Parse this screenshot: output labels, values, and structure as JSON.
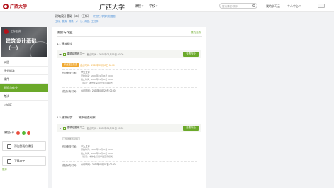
{
  "header": {
    "logo_text": "广西大学",
    "brand": "广西大学",
    "nav_course": "课程",
    "nav_school": "学校",
    "search_placeholder": "搜索课程/教师",
    "my_study": "我的学习云",
    "personal_center": "个人中心"
  },
  "course": {
    "title": "建筑设计基础（二）（王标）",
    "meta": "研究院 | 学校与校园圈",
    "teachers": "王标、樊鹏、曾锐、卢一沙、胡亚、王红孝"
  },
  "sidebar": {
    "cover_small": "王标主讲",
    "cover_title": "建筑设计基础（一）",
    "items": [
      {
        "label": "公告"
      },
      {
        "label": "评分标准"
      },
      {
        "label": "课件"
      },
      {
        "label": "测验与作业"
      },
      {
        "label": "考试"
      },
      {
        "label": "讨论区"
      }
    ],
    "share_label": "课程分享",
    "tool_1": "添加到我的课程",
    "tool_2": "下载APP",
    "collapse": "展开"
  },
  "main": {
    "heading": "测验与作业",
    "link": "提交记录",
    "sections": [
      {
        "title": "1.1 建筑初步",
        "task_name": "建筑绘图练习一",
        "task_date": "截止时间：2020年03月15日 00:00",
        "button": "查看作业",
        "tag": "作业提交状态",
        "tag_date": "截止时间：2020年03月15日 00:00",
        "rows": [
          {
            "label": "作业批改时间：",
            "lines": [
              "学生互评",
              "开始时间：2020年03月16日 00:00",
              "截止时间：2020年03月18日 00:00",
              "（提示：本作业采用学生互评模式）"
            ]
          },
          {
            "label": "成绩公布时间：",
            "lines": [
              "公布时间：2020年03月20日 00:00"
            ]
          }
        ]
      },
      {
        "title": "1.2 建筑初步——城市形态观察",
        "task_name": "建筑绘图练习二",
        "task_date": "截止时间：2020年04月01日 00:00",
        "button": "查看作业",
        "tag": "作业状态公告",
        "tag_date": "",
        "rows": [
          {
            "label": "作业批改时间：",
            "lines": [
              "学生互评",
              "开始时间：2020年04月02日 00:00",
              "截止时间：2020年04月05日 00:00",
              "（提示：本作业采用学生互评模式）"
            ]
          },
          {
            "label": "成绩公布时间：",
            "lines": [
              "公布时间：2020年04月07日 00:00"
            ]
          }
        ]
      }
    ]
  },
  "colors": {
    "accent": "#6ba92a",
    "brand_red": "#b3121b",
    "warning": "#f0a830"
  }
}
